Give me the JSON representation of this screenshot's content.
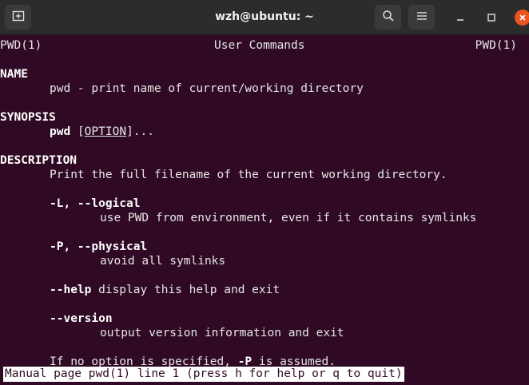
{
  "window": {
    "title": "wzh@ubuntu: ~",
    "icons": [
      "new-tab-icon",
      "search-icon",
      "hamburger-menu-icon",
      "minimize-icon",
      "maximize-icon",
      "close-icon"
    ]
  },
  "man": {
    "header_left": "PWD(1)",
    "header_center": "User Commands",
    "header_right": "PWD(1)",
    "name_heading": "NAME",
    "name_desc": "pwd - print name of current/working directory",
    "synopsis_heading": "SYNOPSIS",
    "synopsis_cmd": "pwd",
    "synopsis_open": "[",
    "synopsis_option": "OPTION",
    "synopsis_close": "]...",
    "description_heading": "DESCRIPTION",
    "description_text": "Print the full filename of the current working directory.",
    "opt_logical": "-L, --logical",
    "opt_logical_desc": "use PWD from environment, even if it contains symlinks",
    "opt_physical": "-P, --physical",
    "opt_physical_desc": "avoid all symlinks",
    "opt_help": "--help",
    "opt_help_desc": " display this help and exit",
    "opt_version": "--version",
    "opt_version_desc": "output version information and exit",
    "default_text_pre": "If no option is specified, ",
    "default_text_opt": "-P",
    "default_text_post": " is assumed."
  },
  "status_bar": "Manual page pwd(1) line 1 (press h for help or q to quit)",
  "colors": {
    "terminal_bg": "#300a24",
    "titlebar_bg": "#2c2c2c",
    "close_button": "#e95420",
    "text": "#e6e6e6"
  }
}
